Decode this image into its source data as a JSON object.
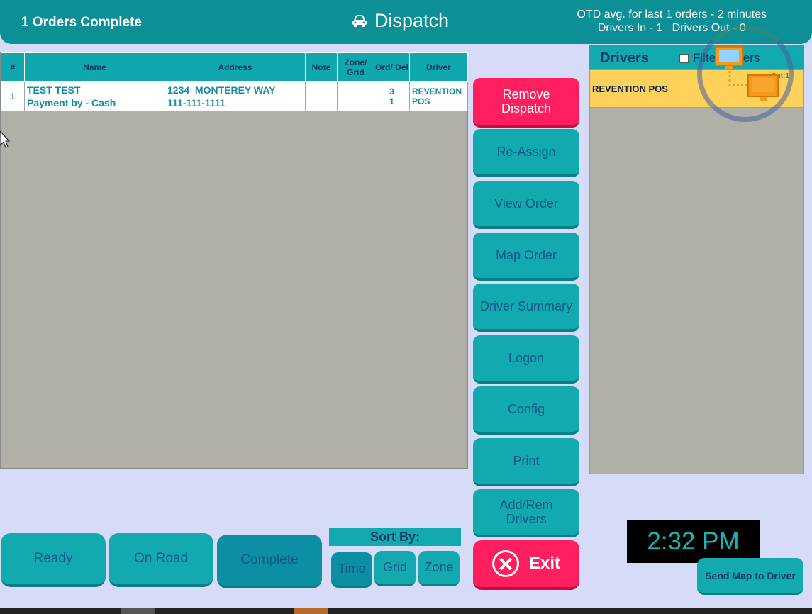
{
  "header": {
    "left": "1 Orders Complete",
    "title": "Dispatch",
    "title_icon": "car-icon",
    "otd": "OTD avg. for last 1 orders - 2 minutes",
    "drivers_status": "Drivers In - 1   Drivers Out - 0"
  },
  "orders": {
    "columns": [
      "#",
      "Name",
      "Address",
      "Note",
      "Zone/ Grid",
      "Ord/ Del",
      "Driver"
    ],
    "rows": [
      {
        "num": "1",
        "name1": "TEST TEST",
        "name2": "Payment by - Cash",
        "addr1": "1234  MONTEREY WAY",
        "addr2": "111-111-1111",
        "note": "",
        "zone": "",
        "ord": "3",
        "del": "1",
        "driver1": "REVENTION",
        "driver2": "POS"
      }
    ]
  },
  "actions": {
    "remove": "Remove Dispatch",
    "reassign": "Re-Assign",
    "view": "View Order",
    "map": "Map Order",
    "summary": "Driver Summary",
    "logon": "Logon",
    "config": "Config",
    "print": "Print",
    "addrem": "Add/Rem Drivers",
    "exit": "Exit"
  },
  "drivers": {
    "title": "Drivers",
    "filter_label": "Filter Orders",
    "filter_checked": false,
    "items": [
      {
        "name": "REVENTION POS",
        "count": "Cnt:1"
      }
    ]
  },
  "tabs": {
    "ready": "Ready",
    "onroad": "On Road",
    "complete": "Complete",
    "active": "Complete"
  },
  "sort": {
    "label": "Sort By:",
    "time": "Time",
    "grid": "Grid",
    "zone": "Zone",
    "active": "Time"
  },
  "clock": "2:32 PM",
  "send_map": "Send Map to Driver",
  "colors": {
    "teal": "#12aaae",
    "red": "#ff1e5e",
    "yellow": "#fdd15a",
    "background": "#d6dcf8"
  }
}
